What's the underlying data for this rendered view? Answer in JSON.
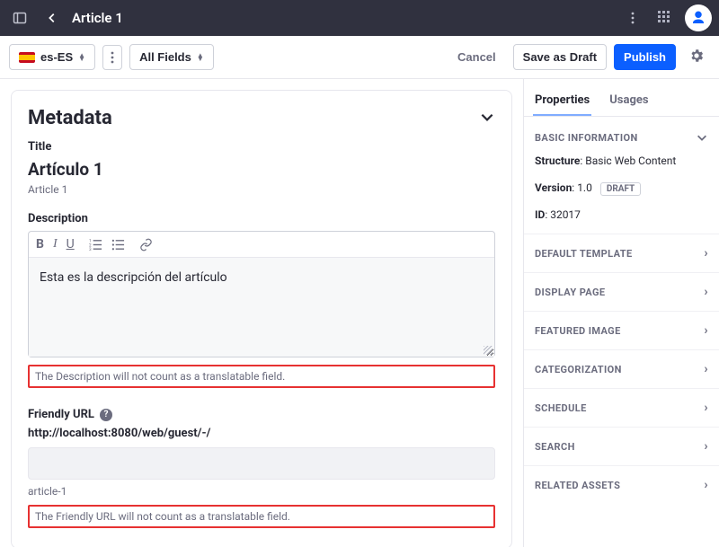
{
  "topbar": {
    "title": "Article 1"
  },
  "toolbar": {
    "locale": "es-ES",
    "fields_label": "All Fields",
    "cancel": "Cancel",
    "save_draft": "Save as Draft",
    "publish": "Publish"
  },
  "metadata": {
    "heading": "Metadata",
    "title_label": "Title",
    "title_value": "Artículo 1",
    "title_original": "Article 1",
    "description_label": "Description",
    "description_value": "Esta es la descripción del artículo",
    "description_note": "The Description will not count as a translatable field.",
    "friendly_url_label": "Friendly URL",
    "friendly_url_base": "http://localhost:8080/web/guest/-/",
    "friendly_url_slug": "article-1",
    "friendly_url_note": "The Friendly URL will not count as a translatable field."
  },
  "side": {
    "tabs": {
      "properties": "Properties",
      "usages": "Usages"
    },
    "basic_info_heading": "BASIC INFORMATION",
    "structure_label": "Structure",
    "structure_value": "Basic Web Content",
    "version_label": "Version",
    "version_value": "1.0",
    "version_badge": "DRAFT",
    "id_label": "ID",
    "id_value": "32017",
    "sections": {
      "default_template": "DEFAULT TEMPLATE",
      "display_page": "DISPLAY PAGE",
      "featured_image": "FEATURED IMAGE",
      "categorization": "CATEGORIZATION",
      "schedule": "SCHEDULE",
      "search": "SEARCH",
      "related_assets": "RELATED ASSETS"
    }
  }
}
